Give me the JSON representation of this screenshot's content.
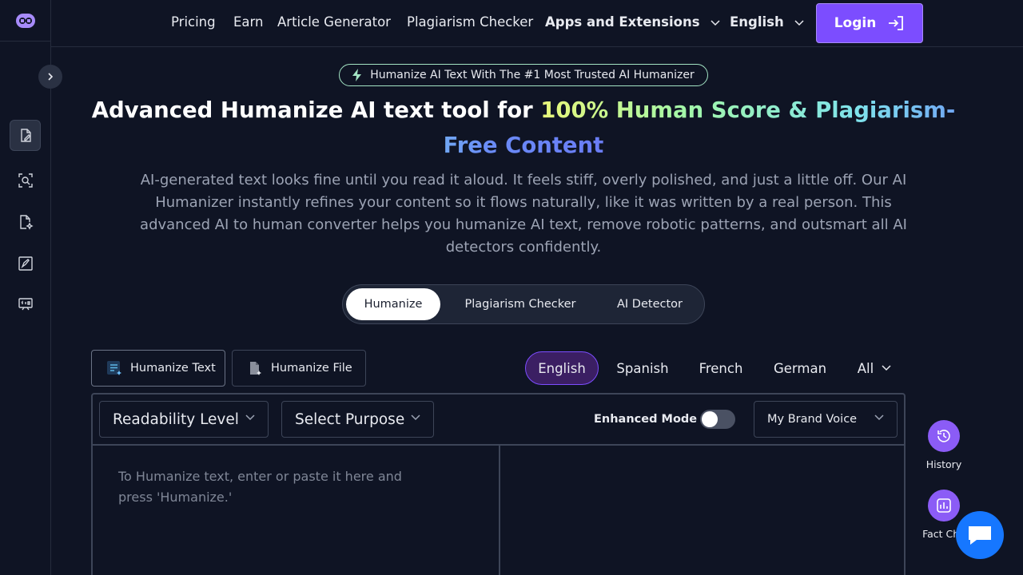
{
  "nav": {
    "links": [
      "Pricing",
      "Earn",
      "Article Generator",
      "Plagiarism Checker"
    ],
    "apps_label": "Apps and Extensions",
    "language_label": "English",
    "login_label": "Login"
  },
  "hero": {
    "badge": "Humanize AI Text With The #1 Most Trusted AI Humanizer",
    "title_plain": "Advanced Humanize AI text tool for ",
    "title_highlight": "100% Human Score & Plagiarism-Free Content",
    "description": "AI-generated text looks fine until you read it aloud. It feels stiff, overly polished, and just a little off. Our AI Humanizer instantly refines your content so it flows naturally, like it was written by a real person. This advanced AI to human converter helps you humanize AI text, remove robotic patterns, and outsmart all AI detectors confidently."
  },
  "mode_tabs": [
    "Humanize",
    "Plagiarism Checker",
    "AI Detector"
  ],
  "input_types": [
    "Humanize Text",
    "Humanize File"
  ],
  "languages": [
    "English",
    "Spanish",
    "French",
    "German",
    "All"
  ],
  "editor": {
    "readability_label": "Readability Level",
    "purpose_label": "Select Purpose",
    "enhanced_mode_label": "Enhanced Mode",
    "brand_voice_label": "My Brand Voice",
    "input_placeholder": "To Humanize text, enter or paste it here and press 'Humanize.'"
  },
  "side_actions": [
    "History",
    "Fact Che"
  ],
  "colors": {
    "accent": "#7c4dff",
    "background": "#0f1424",
    "chat": "#1677ff"
  }
}
